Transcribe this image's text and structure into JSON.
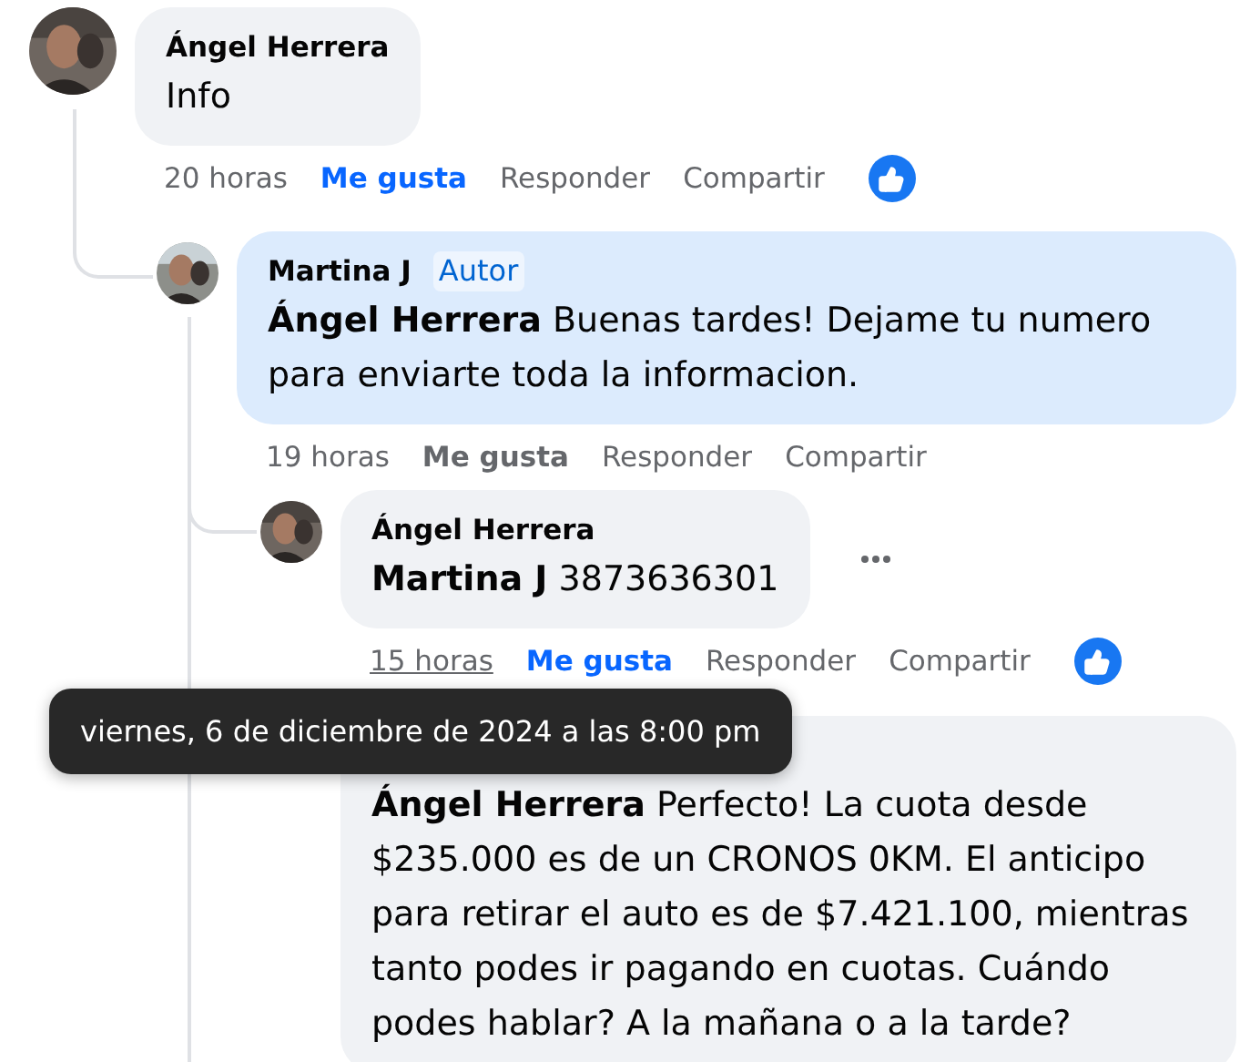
{
  "comments": [
    {
      "author": "Ángel Herrera",
      "text": "Info",
      "time": "20 horas",
      "time_hovered": false,
      "like_label": "Me gusta",
      "liked": true,
      "reply_label": "Responder",
      "share_label": "Compartir",
      "has_like_reaction": true,
      "highlighted": false,
      "show_menu": false,
      "children": [
        {
          "author": "Martina J",
          "badge": "Autor",
          "mention": "Ángel Herrera",
          "text": "Buenas tardes! Dejame tu numero para enviarte toda la informacion.",
          "time": "19 horas",
          "time_hovered": false,
          "like_label": "Me gusta",
          "liked": false,
          "reply_label": "Responder",
          "share_label": "Compartir",
          "has_like_reaction": false,
          "highlighted": true,
          "show_menu": false,
          "children": [
            {
              "author": "Ángel Herrera",
              "mention": "Martina J",
              "text": "3873636301",
              "time": "15 horas",
              "time_hovered": true,
              "like_label": "Me gusta",
              "liked": true,
              "reply_label": "Responder",
              "share_label": "Compartir",
              "has_like_reaction": true,
              "highlighted": false,
              "show_menu": true
            },
            {
              "mention": "Ángel Herrera",
              "text": "Perfecto! La cuota desde $235.000 es de un CRONOS 0KM. El anticipo para retirar el auto es de $7.421.100, mientras tanto podes ir pagando en cuotas. Cuándo podes hablar? A la mañana o a la tarde?",
              "highlighted": false,
              "show_menu": false
            }
          ]
        }
      ]
    }
  ],
  "tooltip": "viernes, 6 de diciembre de 2024 a las 8:00 pm"
}
